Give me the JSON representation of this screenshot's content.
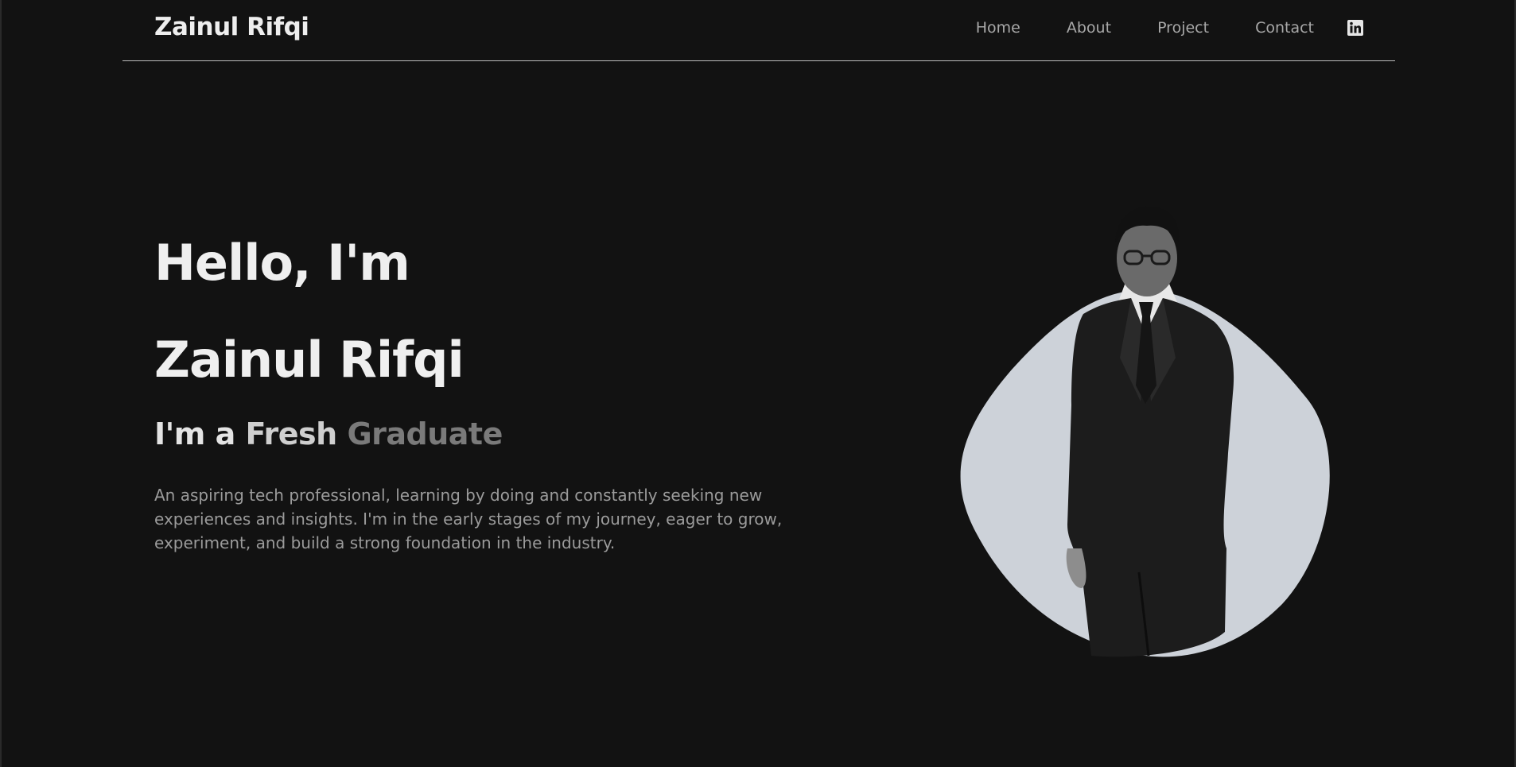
{
  "header": {
    "logo": "Zainul Rifqi",
    "nav": [
      {
        "label": "Home"
      },
      {
        "label": "About"
      },
      {
        "label": "Project"
      },
      {
        "label": "Contact"
      }
    ],
    "social_icon": "linkedin-icon"
  },
  "hero": {
    "greeting": "Hello, I'm",
    "name": "Zainul Rifqi",
    "role_prefix": "I'm a ",
    "role_word1": "Fresh ",
    "role_word2": "Graduate",
    "description": "An aspiring tech professional, learning by doing and constantly seeking new experiences and insights. I'm in the early stages of my journey, eager to grow, experiment, and build a strong foundation in the industry."
  },
  "colors": {
    "background": "#121212",
    "blob": "#cdd2d9",
    "text_primary": "#efefef",
    "text_muted": "#9b9b9b"
  }
}
